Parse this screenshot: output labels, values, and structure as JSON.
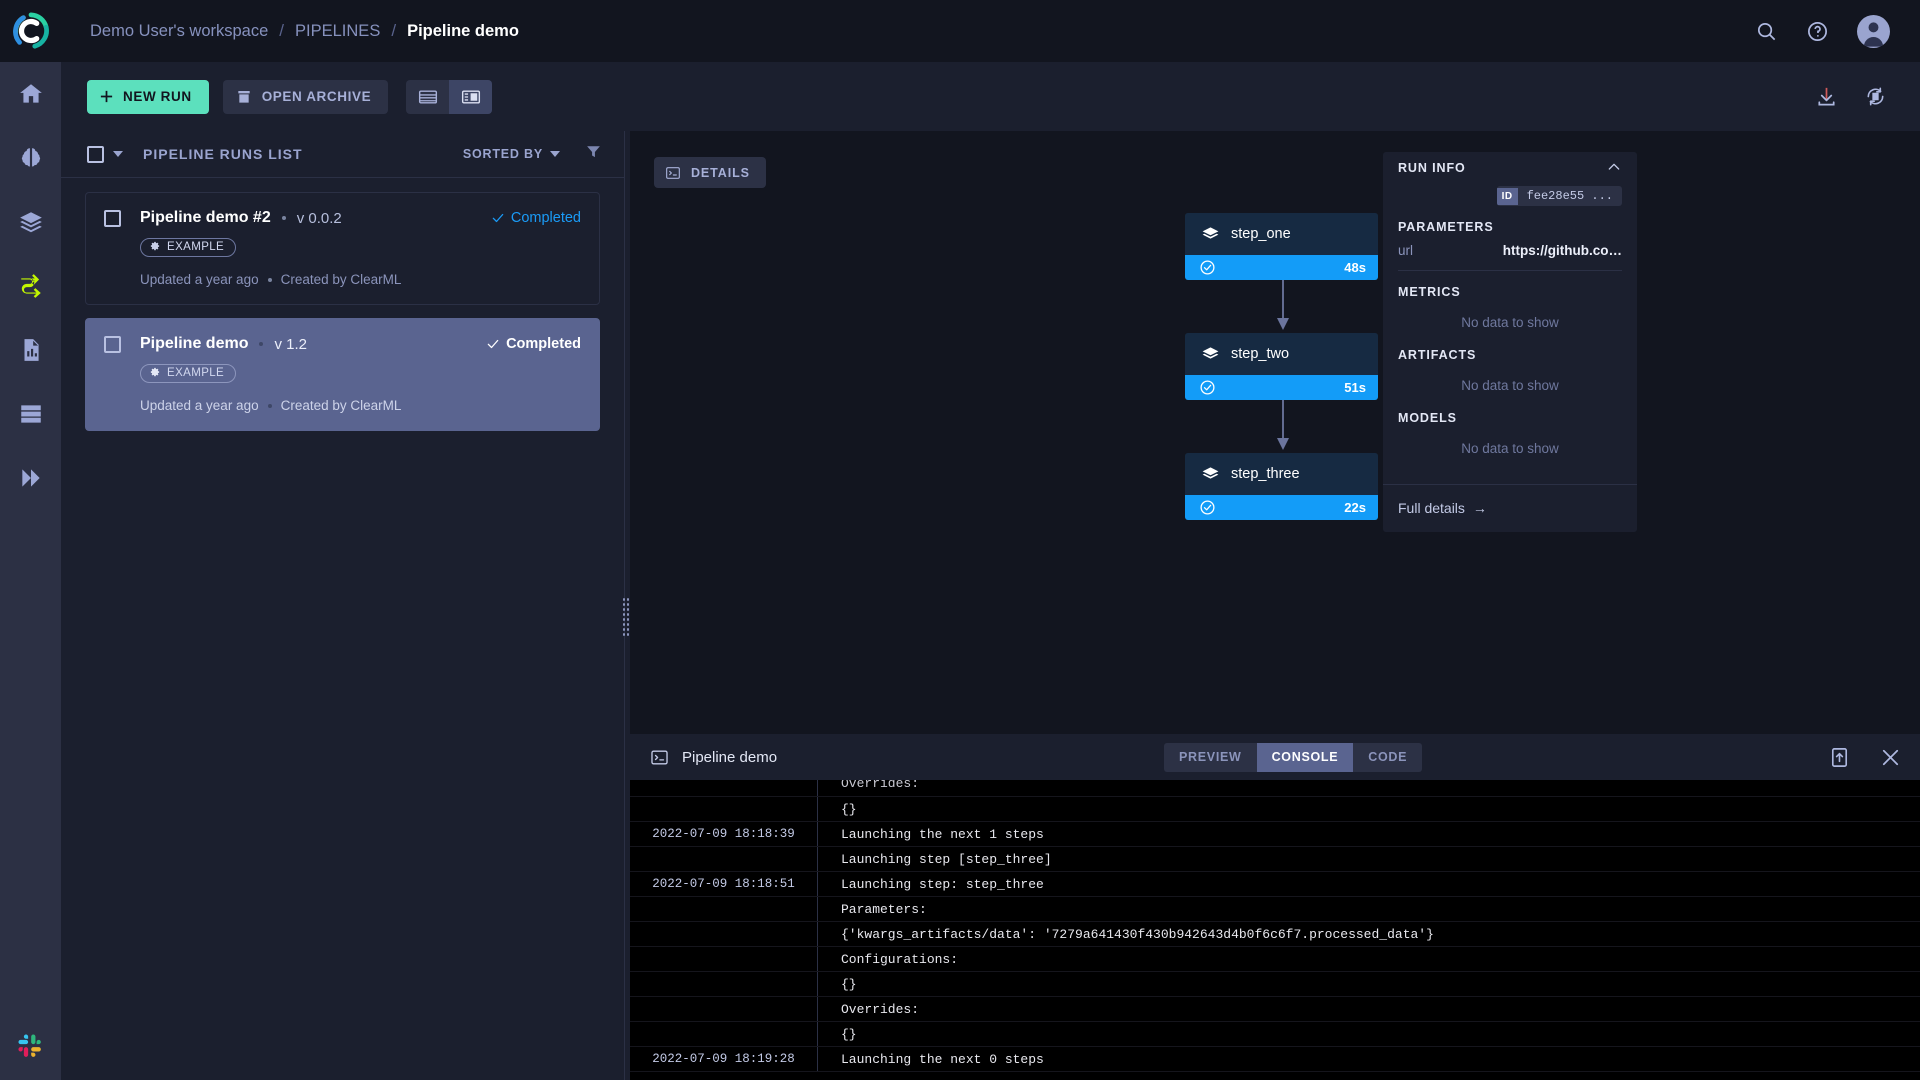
{
  "app": {
    "accent_blue": "#139cf8",
    "accent_green": "#5ce0bd",
    "selected_card": "#5a6490"
  },
  "header": {
    "breadcrumb": [
      {
        "label": "Demo User's workspace",
        "current": false
      },
      {
        "label": "PIPELINES",
        "current": false
      },
      {
        "label": "Pipeline demo",
        "current": true
      }
    ],
    "separator": "/",
    "icons": [
      "search-icon",
      "help-icon",
      "user-avatar"
    ]
  },
  "toolbar": {
    "new_run_label": "NEW RUN",
    "open_archive_label": "OPEN ARCHIVE",
    "view_table_icon": "table-view-icon",
    "view_detail_icon": "detail-view-icon",
    "download_icon": "download-icon",
    "autorefresh_icon": "auto-refresh-pause-icon"
  },
  "sidebar": {
    "items": [
      {
        "name": "home",
        "icon": "home-icon",
        "active": false
      },
      {
        "name": "projects",
        "icon": "brain-icon",
        "active": false
      },
      {
        "name": "datasets",
        "icon": "layers-icon",
        "active": false
      },
      {
        "name": "pipelines",
        "icon": "pipelines-icon",
        "active": true
      },
      {
        "name": "reports",
        "icon": "report-icon",
        "active": false
      },
      {
        "name": "workers",
        "icon": "workers-icon",
        "active": false
      },
      {
        "name": "applications",
        "icon": "double-chevron-icon",
        "active": false
      }
    ],
    "bottom_icon": "slack-icon"
  },
  "runs_list": {
    "title": "PIPELINE RUNS LIST",
    "sorted_by_label": "SORTED BY",
    "filter_icon": "filter-icon",
    "runs": [
      {
        "name": "Pipeline demo #2",
        "version": "v 0.0.2",
        "tag": "EXAMPLE",
        "status": "Completed",
        "updated": "Updated a year ago",
        "created_by": "Created by ClearML",
        "selected": false
      },
      {
        "name": "Pipeline demo",
        "version": "v 1.2",
        "tag": "EXAMPLE",
        "status": "Completed",
        "updated": "Updated a year ago",
        "created_by": "Created by ClearML",
        "selected": true
      }
    ]
  },
  "dag": {
    "details_button": "DETAILS",
    "nodes": [
      {
        "name": "step_one",
        "duration": "48s",
        "status": "completed"
      },
      {
        "name": "step_two",
        "duration": "51s",
        "status": "completed"
      },
      {
        "name": "step_three",
        "duration": "22s",
        "status": "completed"
      }
    ]
  },
  "run_info": {
    "title": "RUN INFO",
    "id_label": "ID",
    "id_value": "fee28e55 ...",
    "parameters_title": "PARAMETERS",
    "param_key": "url",
    "param_value": "https://github.co…",
    "metrics_title": "METRICS",
    "metrics_empty": "No data to show",
    "artifacts_title": "ARTIFACTS",
    "artifacts_empty": "No data to show",
    "models_title": "MODELS",
    "models_empty": "No data to show",
    "full_details": "Full details",
    "full_details_arrow": "→"
  },
  "console": {
    "title": "Pipeline demo",
    "tabs": [
      {
        "label": "PREVIEW",
        "active": false
      },
      {
        "label": "CONSOLE",
        "active": true
      },
      {
        "label": "CODE",
        "active": false
      }
    ],
    "maximize_icon": "maximize-icon",
    "close_icon": "close-icon",
    "lines": [
      {
        "ts": "",
        "msg": "Overrides:",
        "partial": true
      },
      {
        "ts": "",
        "msg": "{}"
      },
      {
        "ts": "2022-07-09 18:18:39",
        "msg": "Launching the next 1 steps"
      },
      {
        "ts": "",
        "msg": "Launching step [step_three]"
      },
      {
        "ts": "2022-07-09 18:18:51",
        "msg": "Launching step: step_three"
      },
      {
        "ts": "",
        "msg": "Parameters:"
      },
      {
        "ts": "",
        "msg": "{'kwargs_artifacts/data': '7279a641430f430b942643d4b0f6c6f7.processed_data'}"
      },
      {
        "ts": "",
        "msg": "Configurations:"
      },
      {
        "ts": "",
        "msg": "{}"
      },
      {
        "ts": "",
        "msg": "Overrides:"
      },
      {
        "ts": "",
        "msg": "{}"
      },
      {
        "ts": "2022-07-09 18:19:28",
        "msg": "Launching the next 0 steps"
      }
    ]
  }
}
